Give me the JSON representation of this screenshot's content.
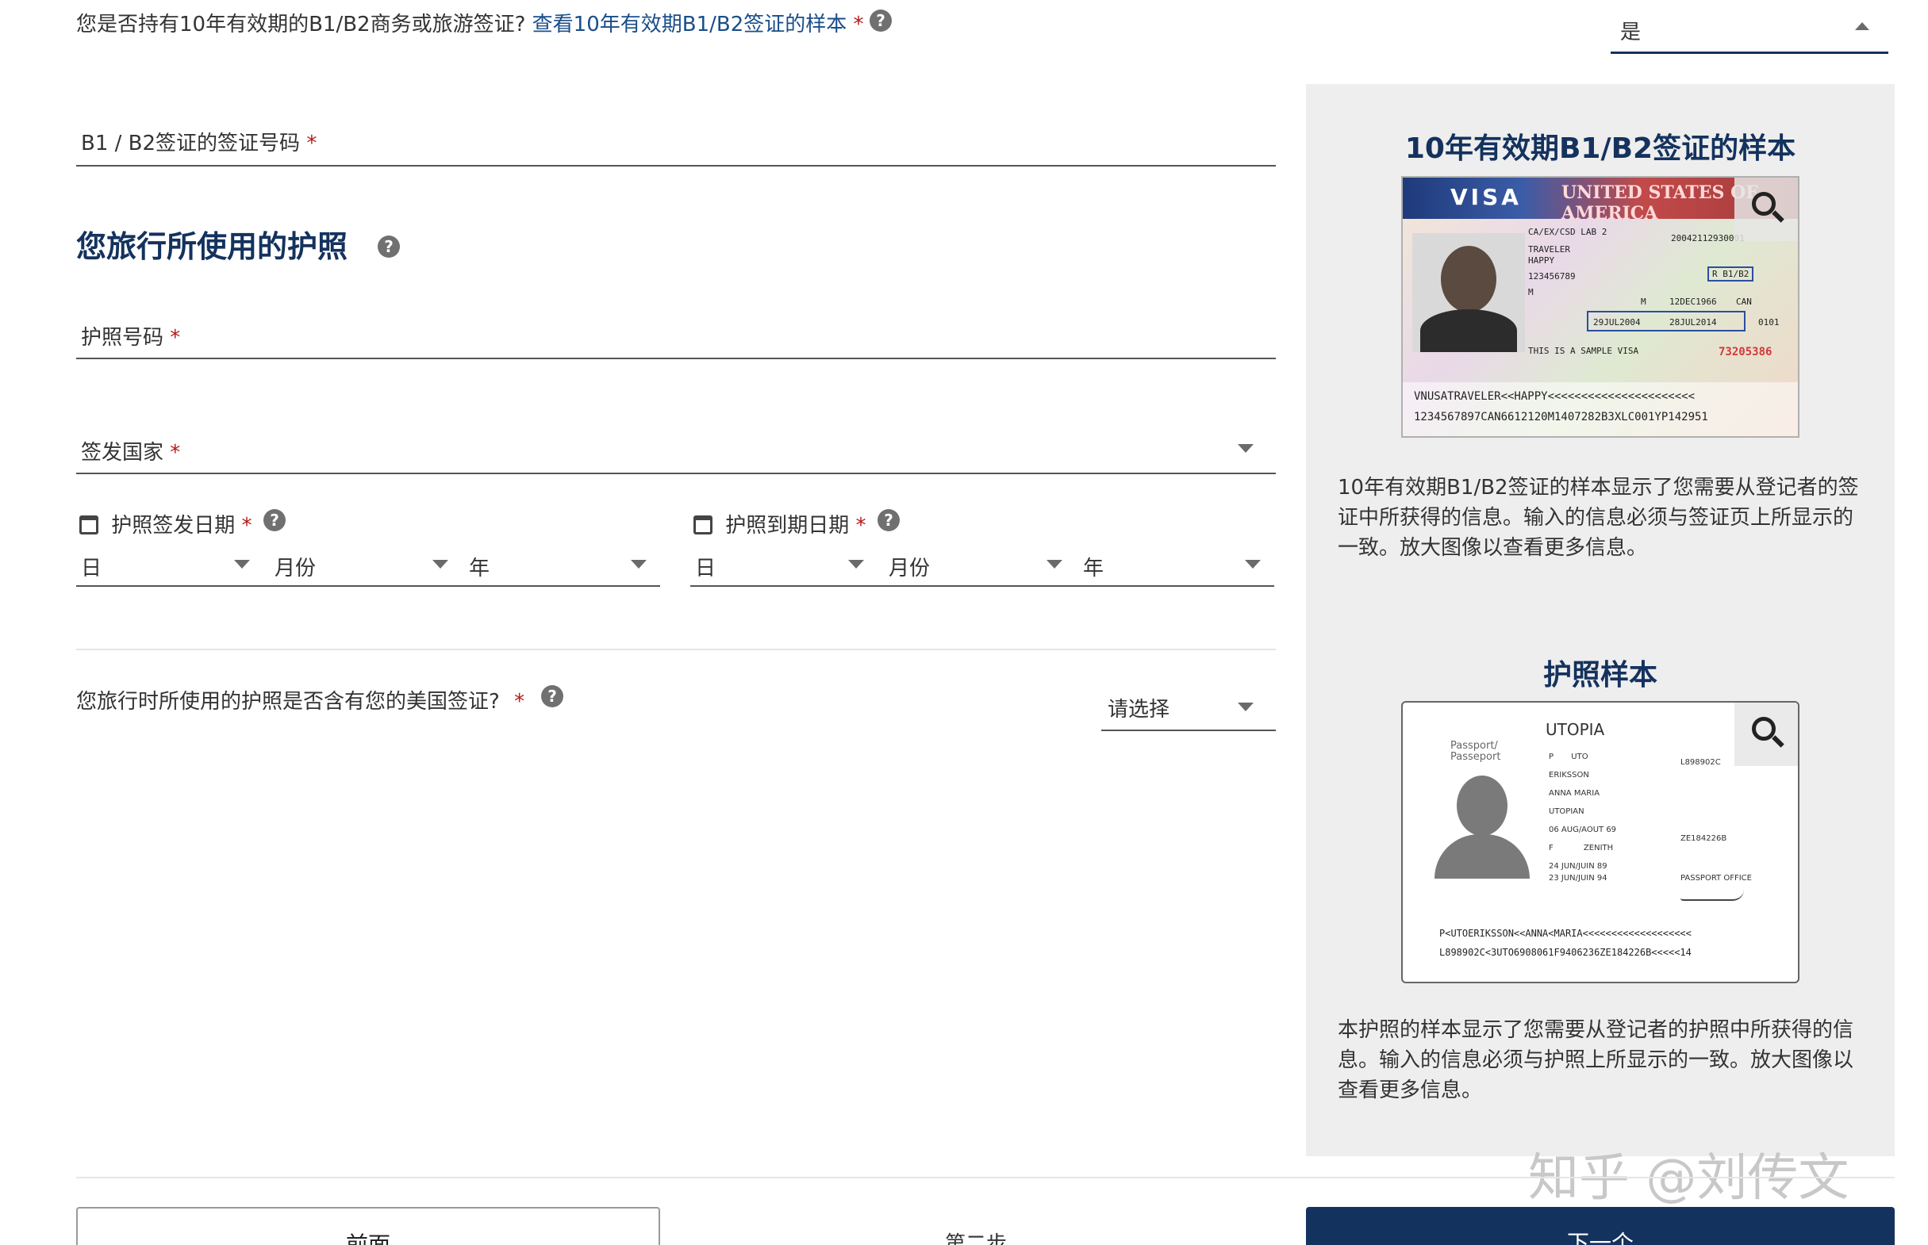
{
  "visa_question": {
    "label": "您是否持有10年有效期的B1/B2商务或旅游签证?",
    "link": "查看10年有效期B1/B2签证的样本",
    "required": "*",
    "answer": "是"
  },
  "visa_number": {
    "label": "B1 / B2签证的签证号码",
    "required": "*"
  },
  "passport_section": {
    "title": "您旅行所使用的护照"
  },
  "passport_number": {
    "label": "护照号码",
    "required": "*"
  },
  "issuing_country": {
    "label": "签发国家",
    "required": "*"
  },
  "issue_date": {
    "label": "护照签发日期",
    "required": "*",
    "day": "日",
    "month": "月份",
    "year": "年"
  },
  "expiry_date": {
    "label": "护照到期日期",
    "required": "*",
    "day": "日",
    "month": "月份",
    "year": "年"
  },
  "contains_visa": {
    "label": "您旅行时所使用的护照是否含有您的美国签证?",
    "required": "*",
    "value": "请选择"
  },
  "visa_sample": {
    "title": "10年有效期B1/B2签证的样本",
    "description": "10年有效期B1/B2签证的样本显示了您需要从登记者的签证中所获得的信息。输入的信息必须与签证页上所显示的一致。放大图像以查看更多信息。",
    "card": {
      "visa_word": "VISA",
      "country": "UNITED STATES OF AMERICA",
      "issuing_post": "CA/EX/CSD LAB 2",
      "control_number": "20042112930001",
      "surname": "TRAVELER",
      "given_name": "HAPPY",
      "visa_type": "R   B1/B2",
      "passport_number": "123456789",
      "sex": "M",
      "birth_date": "12DEC1966",
      "nationality": "CAN",
      "entries": "M",
      "issue_date": "29JUL2004",
      "expiration_date": "28JUL2014",
      "annotation": "THIS IS A SAMPLE VISA",
      "code": "0101",
      "serial": "73205386",
      "mrz1": "VNUSATRAVELER<<HAPPY<<<<<<<<<<<<<<<<<<<<<<",
      "mrz2": "1234567897CAN6612120M1407282B3XLC001YP142951"
    }
  },
  "passport_sample": {
    "title": "护照样本",
    "description": "本护照的样本显示了您需要从登记者的护照中所获得的信息。输入的信息必须与护照上所显示的一致。放大图像以查看更多信息。",
    "card": {
      "country": "UTOPIA",
      "passport_word": "Passport/ Passeport",
      "type": "P",
      "code": "UTO",
      "number": "L898902C",
      "surname": "ERIKSSON",
      "given_names": "ANNA MARIA",
      "nationality": "UTOPIAN",
      "birth_date": "06 AUG/AOUT 69",
      "sex": "F",
      "place": "ZENITH",
      "issue": "24 JUN/JUIN 89",
      "expiry": "23 JUN/JUIN 94",
      "authority": "PASSPORT OFFICE",
      "personal_no": "ZE184226B",
      "mrz1": "P<UTOERIKSSON<<ANNA<MARIA<<<<<<<<<<<<<<<<<<<",
      "mrz2": "L898902C<3UTO6908061F9406236ZE184226B<<<<<14"
    }
  },
  "footer": {
    "prev": "前面",
    "step": "第二步",
    "next": "下一个"
  },
  "watermark": "知乎 @刘传文",
  "colors": {
    "accent": "#14325e",
    "link": "#1a4e8a",
    "required": "#b31b1b",
    "panel": "#eeeeee"
  }
}
